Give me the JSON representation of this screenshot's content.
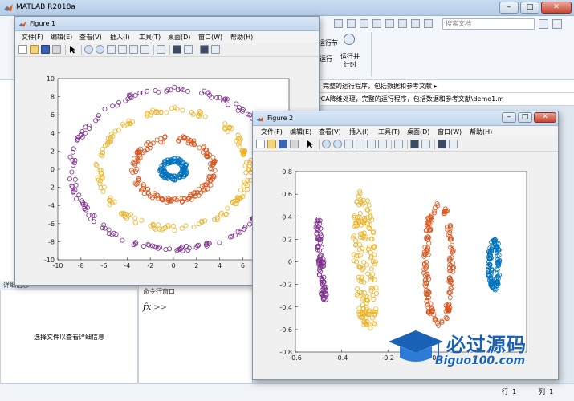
{
  "main_window": {
    "title": "MATLAB R2018a",
    "search_placeholder": "搜索文档",
    "ribbon_run_label": "运行节",
    "ribbon_timer_label": "运行并\n计时",
    "ribbon_side_label": "运行",
    "address_text": "完整的运行程序，包括数据和参考文献 ▸",
    "path_text": "sktop\\KPCA降维处理，完整的运行程序，包括数据和参考文献\\demo1.m",
    "window_buttons": {
      "minimize": "–",
      "maximize": "□",
      "close": "✕"
    }
  },
  "details_panel": {
    "header": "详细信息",
    "placeholder": "选择文件以查看详细信息"
  },
  "command_window": {
    "header": "命令行窗口",
    "fx": "fx",
    "prompt": ">>"
  },
  "status_bar": {
    "row_label": "行",
    "row_value": "1",
    "col_label": "列",
    "col_value": "1"
  },
  "figure_menu": [
    "文件(F)",
    "编辑(E)",
    "查看(V)",
    "插入(I)",
    "工具(T)",
    "桌面(D)",
    "窗口(W)",
    "帮助(H)"
  ],
  "figure1": {
    "title": "Figure 1",
    "chart_data": {
      "type": "scatter",
      "xlim": [
        -10,
        10
      ],
      "ylim": [
        -10,
        10
      ],
      "xticks": [
        -10,
        -8,
        -6,
        -4,
        -2,
        0,
        2,
        4,
        6
      ],
      "yticks": [
        -10,
        -8,
        -6,
        -4,
        -2,
        0,
        2,
        4,
        6,
        8,
        10
      ],
      "series": [
        {
          "color": "#0072bd",
          "shape": "ring",
          "radius": 1.0,
          "noise": 0.25,
          "count": 120
        },
        {
          "color": "#d95319",
          "shape": "ring",
          "radius": 3.4,
          "noise": 0.3,
          "count": 160
        },
        {
          "color": "#edb120",
          "shape": "ring",
          "radius": 6.5,
          "noise": 0.3,
          "count": 170
        },
        {
          "color": "#7e2f8e",
          "shape": "ring",
          "radius": 8.8,
          "noise": 0.25,
          "count": 190
        }
      ]
    }
  },
  "figure2": {
    "title": "Figure 2",
    "chart_data": {
      "type": "scatter",
      "xlim": [
        -0.6,
        0.4
      ],
      "ylim": [
        -0.8,
        0.8
      ],
      "xticks": [
        -0.6,
        -0.4,
        -0.2,
        0
      ],
      "yticks": [
        -0.8,
        -0.6,
        -0.4,
        -0.2,
        0,
        0.2,
        0.4,
        0.6,
        0.8
      ],
      "series": [
        {
          "color": "#7e2f8e",
          "shape": "band",
          "x_center": -0.49,
          "x_amp": 0.015,
          "y_min": -0.34,
          "y_max": 0.38,
          "width": 0.012,
          "count": 90
        },
        {
          "color": "#edb120",
          "shape": "arc",
          "x_center": -0.3,
          "x_amp": 0.05,
          "y_min": -0.58,
          "y_max": 0.62,
          "width": 0.022,
          "count": 170
        },
        {
          "color": "#d95319",
          "shape": "loop",
          "x_center": 0.02,
          "x_amp": 0.055,
          "y_min": -0.56,
          "y_max": 0.52,
          "width": 0.01,
          "count": 170
        },
        {
          "color": "#0072bd",
          "shape": "ellipse",
          "x_center": 0.26,
          "x_amp": 0.018,
          "y_min": -0.25,
          "y_max": 0.2,
          "width": 0.008,
          "count": 120
        }
      ]
    }
  },
  "watermark": {
    "brand": "必过源码",
    "domain": "Biguo100.com"
  }
}
